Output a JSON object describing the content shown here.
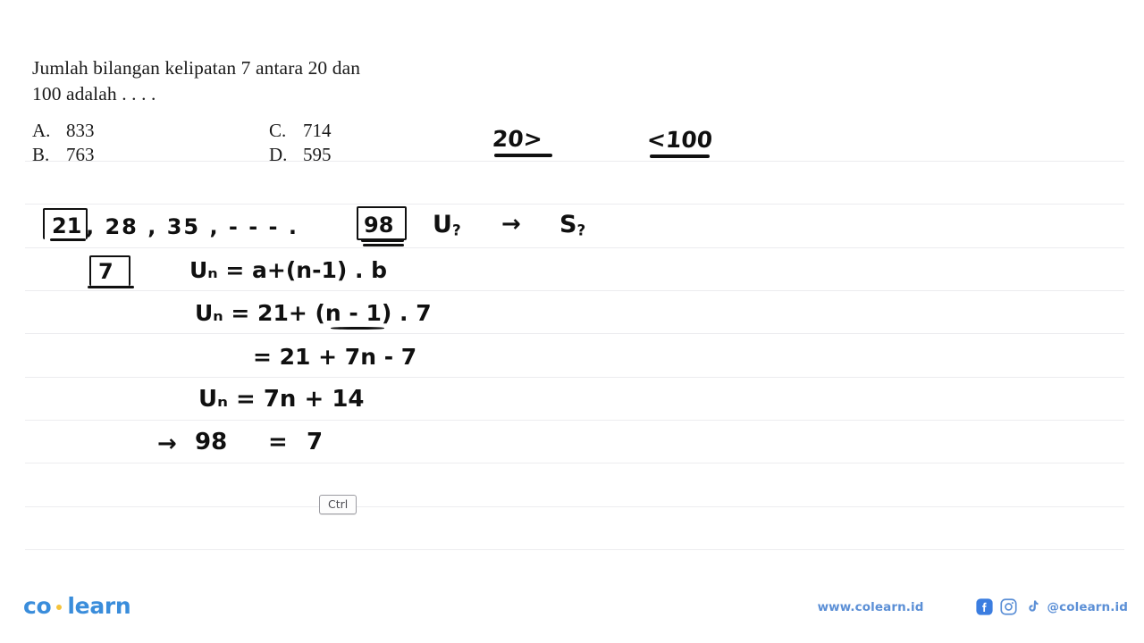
{
  "page": {
    "background": "#ffffff",
    "rule_color": "#ececef",
    "rule_ys": [
      180,
      228,
      277,
      325,
      373,
      422,
      470,
      518,
      567,
      615
    ]
  },
  "question": {
    "line1": "Jumlah bilangan kelipatan 7 antara 20 dan",
    "line2": "100 adalah . . . .",
    "options": [
      {
        "letter": "A.",
        "value": "833"
      },
      {
        "letter": "C.",
        "value": "714"
      },
      {
        "letter": "B.",
        "value": "763"
      },
      {
        "letter": "D.",
        "value": "595"
      }
    ]
  },
  "annotations": {
    "bound_lower": "20>",
    "bound_upper": "<100",
    "sequence_first": "21",
    "sequence_rest": ", 28 , 35 ,  - - - .",
    "sequence_last": "98",
    "target_u": "U",
    "target_u_sub": "?",
    "arrow_to_sum": "→",
    "target_s": "S",
    "target_s_sub": "?",
    "difference_box": "7",
    "formula_general": "Uₙ  =  a+(n-1) . b",
    "formula_substituted": "Uₙ  =  21+ (n - 1) . 7",
    "formula_expanded": "=  21 + 7n - 7",
    "formula_simplified": "Uₙ  = 7n + 14",
    "final_arrow": "→",
    "final_left": "98",
    "final_equals": "=",
    "final_right": "7"
  },
  "ctrl_key": {
    "label": "Ctrl"
  },
  "footer": {
    "logo_left": "co",
    "logo_right": "learn",
    "logo_color": "#3a8ddb",
    "logo_dot_color": "#f5c33b",
    "website": "www.colearn.id",
    "handle": "@colearn.id",
    "social": [
      {
        "name": "facebook-icon"
      },
      {
        "name": "instagram-icon"
      },
      {
        "name": "tiktok-icon"
      }
    ]
  }
}
